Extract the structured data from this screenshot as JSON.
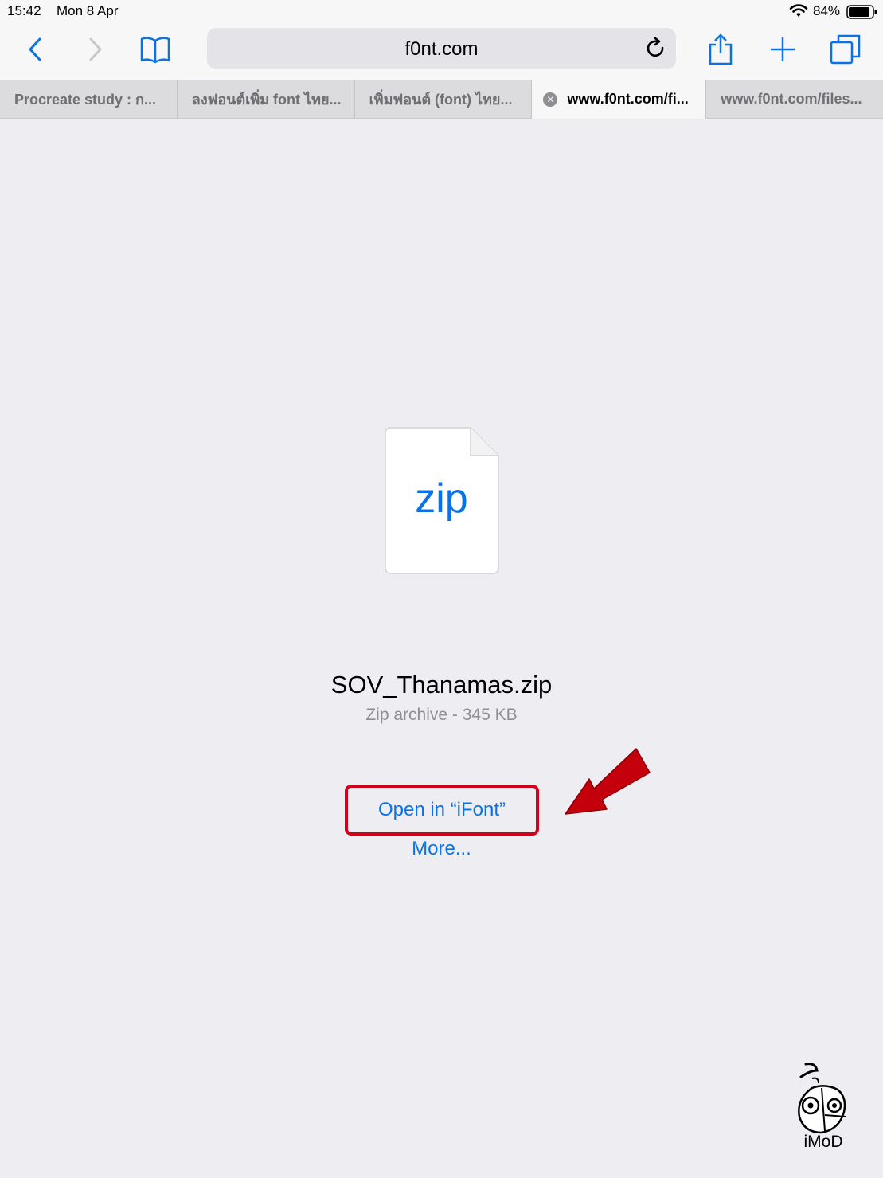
{
  "status_bar": {
    "time": "15:42",
    "date": "Mon 8 Apr",
    "battery_percent": "84%",
    "icons": [
      "wifi-icon",
      "battery-icon"
    ]
  },
  "toolbar": {
    "url": "f0nt.com",
    "icons": [
      "back-icon",
      "forward-icon",
      "bookmarks-icon",
      "reload-icon",
      "share-icon",
      "new-tab-icon",
      "tabs-icon"
    ]
  },
  "tabs": [
    {
      "label": "Procreate study : ก..."
    },
    {
      "label": "ลงฟอนต์เพิ่ม font ไทย..."
    },
    {
      "label": "เพิ่มฟอนต์ (font) ไทย..."
    },
    {
      "label": "www.f0nt.com/fi...",
      "active": true
    },
    {
      "label": "www.f0nt.com/files..."
    }
  ],
  "file": {
    "extension": "zip",
    "name": "SOV_Thanamas.zip",
    "meta": "Zip archive - 345 KB"
  },
  "actions": {
    "open_in": "Open in “iFont”",
    "more": "More..."
  },
  "watermark": {
    "text": "iMoD"
  },
  "colors": {
    "accent": "#0a72e5",
    "highlight": "#d0021b",
    "background": "#eeedf2"
  }
}
